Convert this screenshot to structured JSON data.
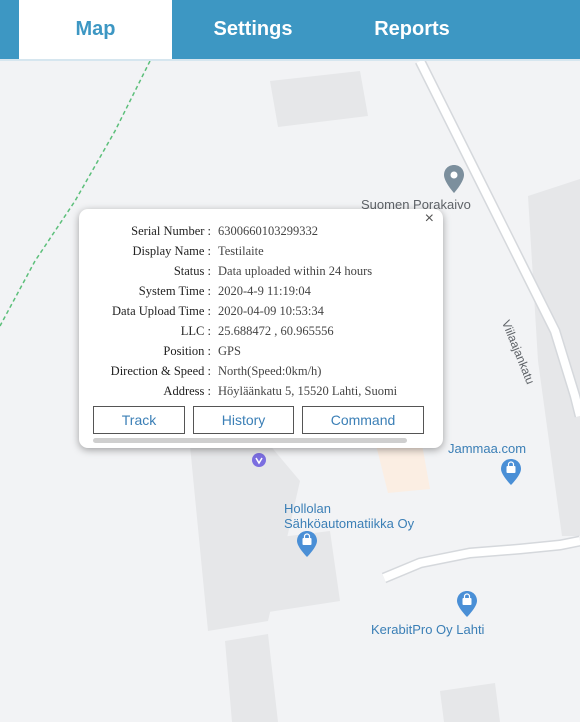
{
  "tabs": [
    {
      "label": "Map",
      "active": true
    },
    {
      "label": "Settings",
      "active": false
    },
    {
      "label": "Reports",
      "active": false
    }
  ],
  "map": {
    "pois": [
      {
        "label": "Suomen Porakaivo",
        "icon": "location-pin-icon"
      },
      {
        "label": "Jammaa.com",
        "icon": "shopping-bag-pin-icon"
      },
      {
        "label_line1": "Hollolan",
        "label_line2": "Sähköautomatiikka Oy",
        "icon": "shopping-bag-pin-icon"
      },
      {
        "label": "KerabitPro Oy Lahti",
        "icon": "shopping-bag-pin-icon"
      }
    ],
    "street": "Viilaajankatu",
    "vehicle_label": "Testilaite",
    "accent_color": "#3d97c3"
  },
  "popup": {
    "rows": [
      {
        "label": "Serial Number :",
        "value": "6300660103299332"
      },
      {
        "label": "Display Name :",
        "value": "Testilaite"
      },
      {
        "label": "Status :",
        "value": " Data uploaded within 24 hours"
      },
      {
        "label": "System Time :",
        "value": "2020-4-9 11:19:04"
      },
      {
        "label": "Data Upload Time :",
        "value": "2020-04-09 10:53:34"
      },
      {
        "label": "LLC :",
        "value": "25.688472 , 60.965556"
      },
      {
        "label": "Position :",
        "value": "GPS"
      },
      {
        "label": "Direction & Speed :",
        "value": "North(Speed:0km/h)"
      },
      {
        "label": "Address :",
        "value": "Höyläänkatu 5, 15520 Lahti, Suomi"
      }
    ],
    "buttons": {
      "track": "Track",
      "history": "History",
      "command": "Command"
    },
    "close_glyph": "×"
  }
}
